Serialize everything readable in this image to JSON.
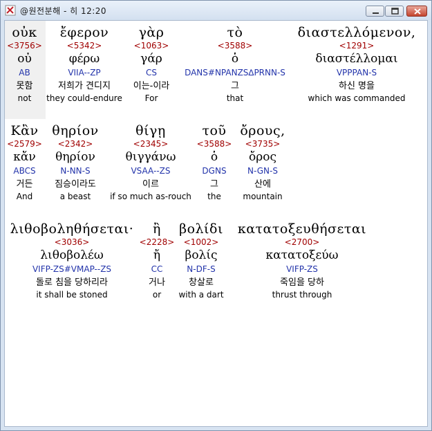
{
  "window": {
    "title": "@원전분해 - 히 12:20"
  },
  "rows": [
    {
      "words": [
        {
          "greek": "οὐκ",
          "strong": "<3756>",
          "lemma": "οὐ",
          "parse": "AB",
          "korean": "못함",
          "english": "not"
        },
        {
          "greek": "ἔφερον",
          "strong": "<5342>",
          "lemma": "φέρω",
          "parse": "VIIA--ZP",
          "korean": "저희가 견디지",
          "english": "they could-endure"
        },
        {
          "greek": "γὰρ",
          "strong": "<1063>",
          "lemma": "γάρ",
          "parse": "CS",
          "korean": "이는-이라",
          "english": "For"
        },
        {
          "greek": "τὸ",
          "strong": "<3588>",
          "lemma": "ὁ",
          "parse": "DANS#NPANZS∆PRNN-S",
          "korean": "그",
          "english": "that"
        },
        {
          "greek": "διαστελλόμενον,",
          "strong": "<1291>",
          "lemma": "διαστέλλομαι",
          "parse": "VPPPAN-S",
          "korean": "하신 명을",
          "english": "which was commanded"
        }
      ]
    },
    {
      "words": [
        {
          "greek": "Κἂν",
          "strong": "<2579>",
          "lemma": "κἄν",
          "parse": "ABCS",
          "korean": "거든",
          "english": "And"
        },
        {
          "greek": "θηρίον",
          "strong": "<2342>",
          "lemma": "θηρίον",
          "parse": "N-NN-S",
          "korean": "짐승이라도",
          "english": "a beast"
        },
        {
          "greek": "θίγῃ",
          "strong": "<2345>",
          "lemma": "θιγγάνω",
          "parse": "VSAA--ZS",
          "korean": "이르",
          "english": "if so much as-rouch"
        },
        {
          "greek": "τοῦ",
          "strong": "<3588>",
          "lemma": "ὁ",
          "parse": "DGNS",
          "korean": "그",
          "english": "the"
        },
        {
          "greek": "ὄρους,",
          "strong": "<3735>",
          "lemma": "ὄρος",
          "parse": "N-GN-S",
          "korean": "산에",
          "english": "mountain"
        }
      ]
    },
    {
      "words": [
        {
          "greek": "λιθοβοληθήσεται·",
          "strong": "<3036>",
          "lemma": "λιθοβολέω",
          "parse": "VIFP-ZS#VMAP--ZS",
          "korean": "돌로 침을 당하리라",
          "english": "it shall be stoned"
        },
        {
          "greek": "ἢ",
          "strong": "<2228>",
          "lemma": "ἤ",
          "parse": "CC",
          "korean": "거나",
          "english": "or"
        },
        {
          "greek": "βολίδι",
          "strong": "<1002>",
          "lemma": "βολίς",
          "parse": "N-DF-S",
          "korean": "창살로",
          "english": "with a dart"
        },
        {
          "greek": "κατατοξευθήσεται",
          "strong": "<2700>",
          "lemma": "κατατοξεύω",
          "parse": "VIFP-ZS",
          "korean": "죽임을 당하",
          "english": "thrust through"
        }
      ]
    }
  ]
}
